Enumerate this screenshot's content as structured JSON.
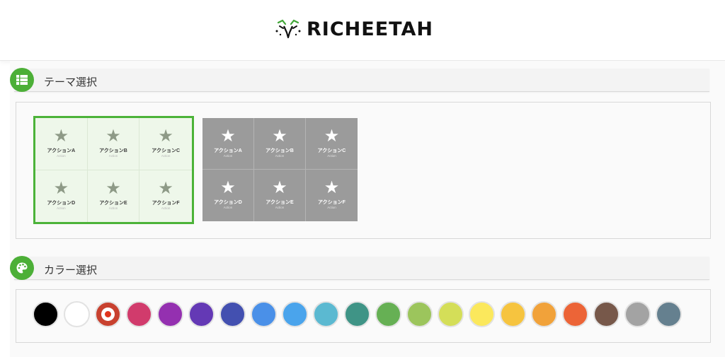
{
  "header": {
    "logo_text": "RICHEETAH"
  },
  "theme_section": {
    "title": "テーマ選択",
    "icon": "grid-list-icon",
    "themes": [
      {
        "style": "light",
        "selected": true,
        "cells": [
          {
            "name": "アクションA",
            "sub": "Action"
          },
          {
            "name": "アクションB",
            "sub": "Action"
          },
          {
            "name": "アクションC",
            "sub": "Action"
          },
          {
            "name": "アクションD",
            "sub": "Action"
          },
          {
            "name": "アクションE",
            "sub": "Action"
          },
          {
            "name": "アクションF",
            "sub": "Action"
          }
        ]
      },
      {
        "style": "dark",
        "selected": false,
        "cells": [
          {
            "name": "アクションA",
            "sub": "Action"
          },
          {
            "name": "アクションB",
            "sub": "Action"
          },
          {
            "name": "アクションC",
            "sub": "Action"
          },
          {
            "name": "アクションD",
            "sub": "Action"
          },
          {
            "name": "アクションE",
            "sub": "Action"
          },
          {
            "name": "アクションF",
            "sub": "Action"
          }
        ]
      }
    ]
  },
  "color_section": {
    "title": "カラー選択",
    "icon": "palette-icon",
    "selected_index": 2,
    "colors": [
      "#000000",
      "#ffffff",
      "#c8412f",
      "#d13b6c",
      "#9430b0",
      "#6439b5",
      "#4350b0",
      "#4a90e8",
      "#4aa4ec",
      "#5bb9d1",
      "#3f9486",
      "#66b054",
      "#9cc55c",
      "#d4de58",
      "#fbe85c",
      "#f6c43f",
      "#f1a23a",
      "#ec6437",
      "#77584a",
      "#a3a3a3",
      "#65808f"
    ]
  }
}
